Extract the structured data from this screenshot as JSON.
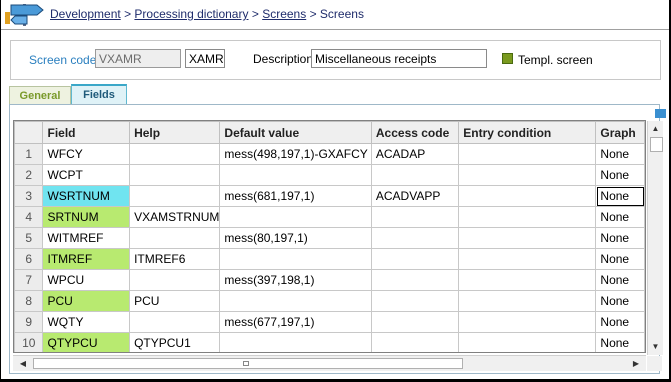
{
  "breadcrumb": {
    "items": [
      "Development",
      "Processing dictionary",
      "Screens"
    ],
    "separator": ">",
    "current": "Screens"
  },
  "header": {
    "screen_code_label": "Screen code",
    "screen_code_value": "VXAMR",
    "screen_code_alt": "XAMR",
    "description_label": "Description",
    "description_value": "Miscellaneous receipts",
    "templ_label": "Templ. screen",
    "templ_checked": true
  },
  "tabs": [
    {
      "label": "General",
      "active": false
    },
    {
      "label": "Fields",
      "active": true
    }
  ],
  "grid": {
    "columns": [
      "Field",
      "Help",
      "Default value",
      "Access code",
      "Entry condition",
      "Graph"
    ],
    "rows": [
      {
        "n": "1",
        "field": "WFCY",
        "help": "",
        "default": "mess(498,197,1)-GXAFCY",
        "access": "ACADAP",
        "entry": "",
        "graph": "None",
        "color": ""
      },
      {
        "n": "2",
        "field": "WCPT",
        "help": "",
        "default": "",
        "access": "",
        "entry": "",
        "graph": "None",
        "color": ""
      },
      {
        "n": "3",
        "field": "WSRTNUM",
        "help": "",
        "default": "mess(681,197,1)",
        "access": "ACADVAPP",
        "entry": "",
        "graph": "None",
        "color": "cyan"
      },
      {
        "n": "4",
        "field": "SRTNUM",
        "help": "VXAMSTRNUM",
        "default": "",
        "access": "",
        "entry": "",
        "graph": "None",
        "color": "green"
      },
      {
        "n": "5",
        "field": "WITMREF",
        "help": "",
        "default": "mess(80,197,1)",
        "access": "",
        "entry": "",
        "graph": "None",
        "color": ""
      },
      {
        "n": "6",
        "field": "ITMREF",
        "help": "ITMREF6",
        "default": "",
        "access": "",
        "entry": "",
        "graph": "None",
        "color": "green"
      },
      {
        "n": "7",
        "field": "WPCU",
        "help": "",
        "default": "mess(397,198,1)",
        "access": "",
        "entry": "",
        "graph": "None",
        "color": ""
      },
      {
        "n": "8",
        "field": "PCU",
        "help": "PCU",
        "default": "",
        "access": "",
        "entry": "",
        "graph": "None",
        "color": "green"
      },
      {
        "n": "9",
        "field": "WQTY",
        "help": "",
        "default": "mess(677,197,1)",
        "access": "",
        "entry": "",
        "graph": "None",
        "color": ""
      },
      {
        "n": "10",
        "field": "QTYPCU",
        "help": "QTYPCU1",
        "default": "",
        "access": "",
        "entry": "",
        "graph": "None",
        "color": "green"
      }
    ]
  },
  "colors": {
    "link": "#1f2c6b",
    "label_blue": "#2a7fbf",
    "field_green": "#b8ea70",
    "field_cyan": "#70e4f0",
    "tab_active": "#3aa7c8"
  },
  "icons": {
    "app": "signpost-icon",
    "scroll_up": "arrow-up-icon",
    "scroll_down": "arrow-down-icon",
    "scroll_left": "arrow-left-icon",
    "scroll_right": "arrow-right-icon"
  }
}
